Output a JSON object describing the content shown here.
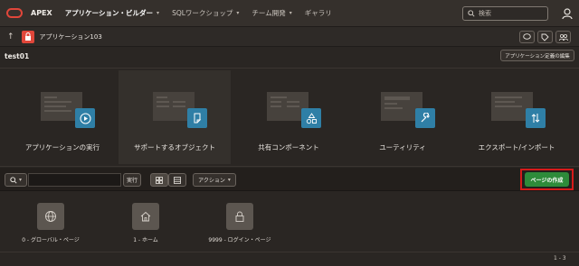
{
  "nav": {
    "brand": "APEX",
    "items": [
      {
        "label": "アプリケーション・ビルダー",
        "active": true
      },
      {
        "label": "SQLワークショップ",
        "active": false
      },
      {
        "label": "チーム開発",
        "active": false
      },
      {
        "label": "ギャラリ",
        "active": false
      }
    ],
    "search_placeholder": "検索"
  },
  "appbar": {
    "app_name": "アプリケーション103"
  },
  "page": {
    "title": "test01",
    "edit_button": "アプリケーション定義の編集"
  },
  "tiles": [
    {
      "label": "アプリケーションの実行",
      "icon": "play-icon"
    },
    {
      "label": "サポートするオブジェクト",
      "icon": "document-icon"
    },
    {
      "label": "共有コンポーネント",
      "icon": "shapes-icon"
    },
    {
      "label": "ユーティリティ",
      "icon": "wrench-icon"
    },
    {
      "label": "エクスポート/インポート",
      "icon": "transfer-icon"
    }
  ],
  "toolbar": {
    "go_label": "実行",
    "actions_label": "アクション",
    "create_label": "ページの作成"
  },
  "pages": [
    {
      "label": "0 - グローバル・ページ",
      "icon": "globe-icon"
    },
    {
      "label": "1 - ホーム",
      "icon": "home-icon"
    },
    {
      "label": "9999 - ログイン・ページ",
      "icon": "lock-icon"
    }
  ],
  "pagination": "1 - 3",
  "colors": {
    "accent_red": "#e0463a",
    "create_green": "#2e8b3a",
    "highlight_box": "#d51b1b",
    "tile_blue": "#2f7fa6"
  }
}
